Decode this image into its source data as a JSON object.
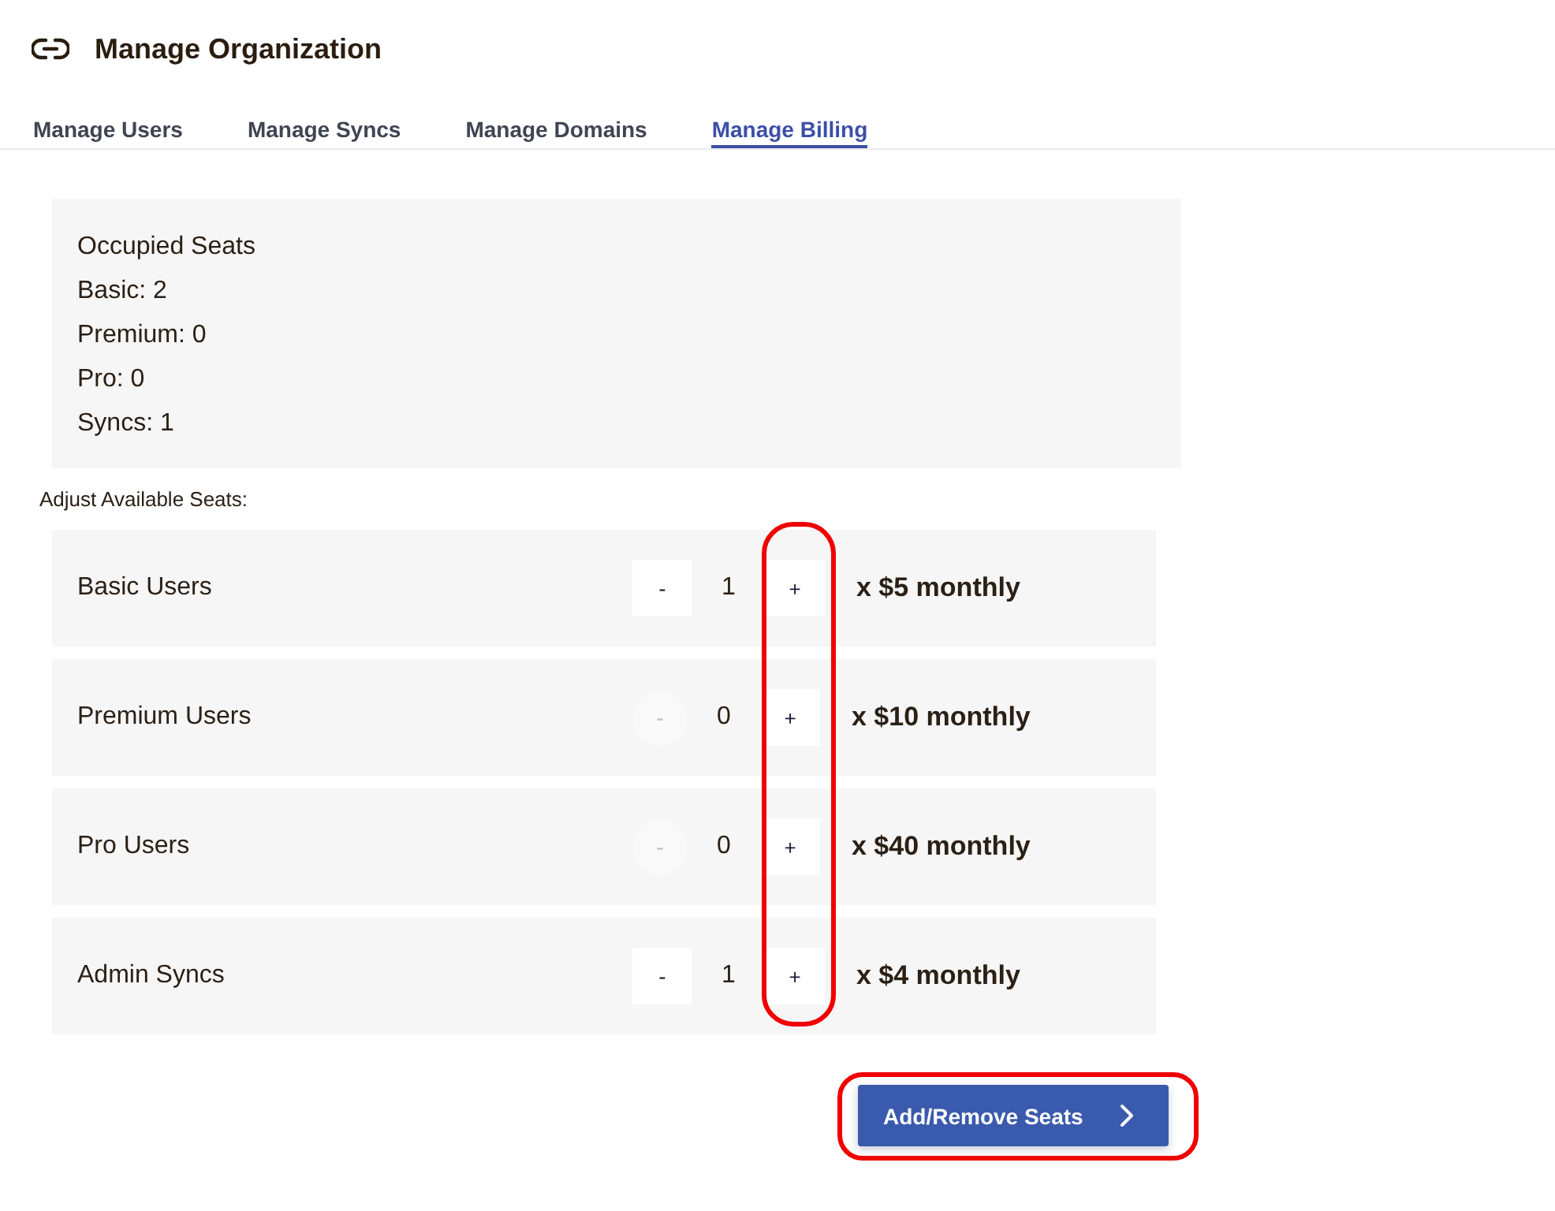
{
  "header": {
    "title": "Manage Organization"
  },
  "tabs": [
    {
      "label": "Manage Users",
      "selected": false
    },
    {
      "label": "Manage Syncs",
      "selected": false
    },
    {
      "label": "Manage Domains",
      "selected": false
    },
    {
      "label": "Manage Billing",
      "selected": true
    }
  ],
  "occupied": {
    "title": "Occupied Seats",
    "lines": [
      "Basic: 2",
      "Premium: 0",
      "Pro: 0",
      "Syncs: 1"
    ]
  },
  "adjust": {
    "label": "Adjust Available Seats:",
    "plus_column_circled": true,
    "rows": [
      {
        "name": "Basic Users",
        "minus": "-",
        "minus_disabled": false,
        "count": "1",
        "plus": "+",
        "price": "x $5 monthly"
      },
      {
        "name": "Premium Users",
        "minus": "-",
        "minus_disabled": true,
        "count": "0",
        "plus": "+",
        "price": "x $10 monthly"
      },
      {
        "name": "Pro Users",
        "minus": "-",
        "minus_disabled": true,
        "count": "0",
        "plus": "+",
        "price": "x $40 monthly"
      },
      {
        "name": "Admin Syncs",
        "minus": "-",
        "minus_disabled": false,
        "count": "1",
        "plus": "+",
        "price": "x $4 monthly"
      }
    ]
  },
  "submit": {
    "label": "Add/Remove Seats",
    "circled": true
  }
}
